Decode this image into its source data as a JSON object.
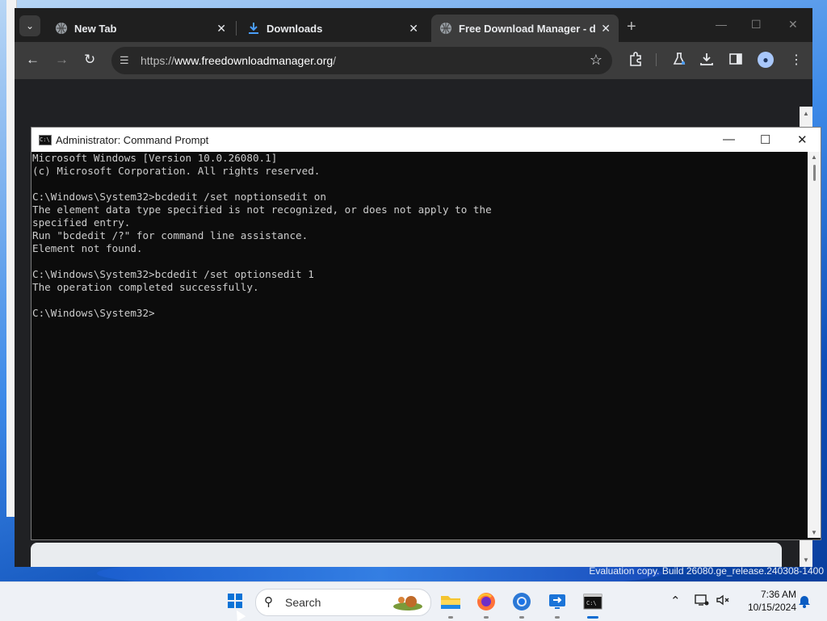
{
  "browser": {
    "tabs": [
      {
        "label": "New Tab",
        "icon": "globe-icon",
        "active": false
      },
      {
        "label": "Downloads",
        "icon": "download-icon",
        "active": false
      },
      {
        "label": "Free Download Manager - dov",
        "icon": "globe-icon",
        "active": true
      }
    ],
    "url": {
      "scheme": "https://",
      "host": "www.freedownloadmanager.org",
      "path": "/"
    }
  },
  "cmd": {
    "title": "Administrator: Command Prompt",
    "lines": [
      "Microsoft Windows [Version 10.0.26080.1]",
      "(c) Microsoft Corporation. All rights reserved.",
      "",
      "C:\\Windows\\System32>bcdedit /set noptionsedit on",
      "The element data type specified is not recognized, or does not apply to the",
      "specified entry.",
      "Run \"bcdedit /?\" for command line assistance.",
      "Element not found.",
      "",
      "C:\\Windows\\System32>bcdedit /set optionsedit 1",
      "The operation completed successfully.",
      "",
      "C:\\Windows\\System32>"
    ]
  },
  "watermark": "Evaluation copy. Build 26080.ge_release.240308-1400",
  "taskbar": {
    "search_placeholder": "Search",
    "apps": [
      "file-explorer-icon",
      "firefox-icon",
      "chrome-icon",
      "remote-desktop-icon",
      "terminal-icon"
    ],
    "time": "7:36 AM",
    "date": "10/15/2024"
  }
}
